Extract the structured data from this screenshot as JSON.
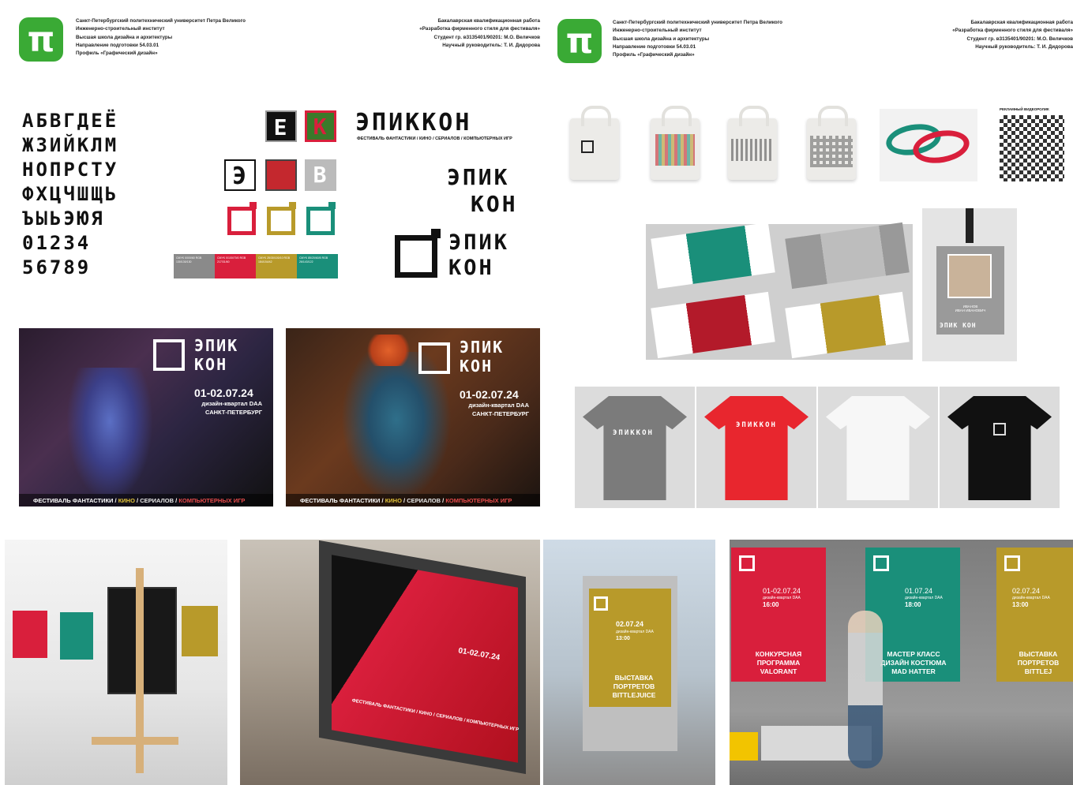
{
  "header_left": {
    "logo_glyph": "π",
    "lines": [
      "Санкт-Петербургский политехнический университет Петра Великого",
      "Инженерно-строительный институт",
      "Высшая школа дизайна и архитектуры",
      "Направление подготовки 54.03.01",
      "Профиль «Графический дизайн»"
    ]
  },
  "header_right": {
    "lines": [
      "Бакалаврская квалификационная работа",
      "«Разработка фирменного стиля для фестиваля»",
      "Студент гр. в3135401/90201: М.О. Величков",
      "Научный руководитель: Т. И. Дидорова"
    ]
  },
  "alphabet": {
    "rows": [
      "АБВГДЕЁ",
      "ЖЗИЙКЛМ",
      "НОПРСТУ",
      "ФХЦЧШЩЬ",
      "ЪЫЬЭЮЯ",
      "01234",
      "56789"
    ]
  },
  "logo_words": {
    "main": "ЭПИККОН",
    "tagline": "ФЕСТИВАЛЬ ФАНТАСТИКИ / КИНО / СЕРИАЛОВ / КОМПЬЮТЕРНЫХ ИГР",
    "line1": "ЭПИК",
    "line2": "КОН",
    "icon_e": "Е",
    "icon_k": "К",
    "icon_z": "Э",
    "icon_v": "В"
  },
  "colors": {
    "grey": "#8a8a8a",
    "red": "#d91f3c",
    "olive": "#b89a2a",
    "teal": "#1a8f7a",
    "green": "#3aaa35"
  },
  "swatches": [
    {
      "label": "CMYK 0/0/0/60 RGB 130/130/130"
    },
    {
      "label": "CMYK 0/100/70/0 RGB 217/31/60"
    },
    {
      "label": "CMYK 25/30/100/10 RGB 184/154/42"
    },
    {
      "label": "CMYK 85/20/60/5 RGB 26/143/122"
    }
  ],
  "posters": [
    {
      "title1": "ЭПИК",
      "title2": "КОН",
      "date": "01-02.07.24",
      "venue": "дизайн-квартал DAA",
      "city": "САНКТ-ПЕТЕРБУРГ",
      "foot_a": "ФЕСТИВАЛЬ ФАНТАСТИКИ",
      "foot_b": "КИНО",
      "foot_c": "СЕРИАЛОВ",
      "foot_d": "КОМПЬЮТЕРНЫХ ИГР"
    },
    {
      "title1": "ЭПИК",
      "title2": "КОН",
      "date": "01-02.07.24",
      "venue": "дизайн-квартал DAA",
      "city": "САНКТ-ПЕТЕРБУРГ",
      "foot_a": "ФЕСТИВАЛЬ ФАНТАСТИКИ",
      "foot_b": "КИНО",
      "foot_c": "СЕРИАЛОВ",
      "foot_d": "КОМПЬЮТЕРНЫХ ИГР"
    }
  ],
  "qr_label": "РЕКЛАМНЫЙ ВИДЕОРОЛИК",
  "badge": {
    "name": "ИВАНОВ\nИВАН ИВАНОВИЧ",
    "logo": "ЭПИК КОН"
  },
  "street_poster": {
    "date": "02.07.24",
    "venue": "дизайн-квартал DAA",
    "time": "13:00",
    "event": "ВЫСТАВКА ПОРТРЕТОВ BITTLEJUICE"
  },
  "billboard": {
    "date": "01-02.07.24",
    "foot": "ФЕСТИВАЛЬ ФАНТАСТИКИ / КИНО / СЕРИАЛОВ / КОМПЬЮТЕРНЫХ ИГР"
  },
  "wall_posters": [
    {
      "date": "01-02.07.24",
      "venue": "дизайн-квартал DAA",
      "time": "16:00",
      "event": "КОНКУРСНАЯ ПРОГРАММА VALORANT"
    },
    {
      "date": "01.07.24",
      "venue": "дизайн-квартал DAA",
      "time": "18:00",
      "event": "МАСТЕР КЛАСС ДИЗАЙН КОСТЮМА MAD HATTER"
    },
    {
      "date": "02.07.24",
      "venue": "дизайн-квартал DAA",
      "time": "13:00",
      "event": "ВЫСТАВКА ПОРТРЕТОВ BITTLEJ"
    }
  ]
}
